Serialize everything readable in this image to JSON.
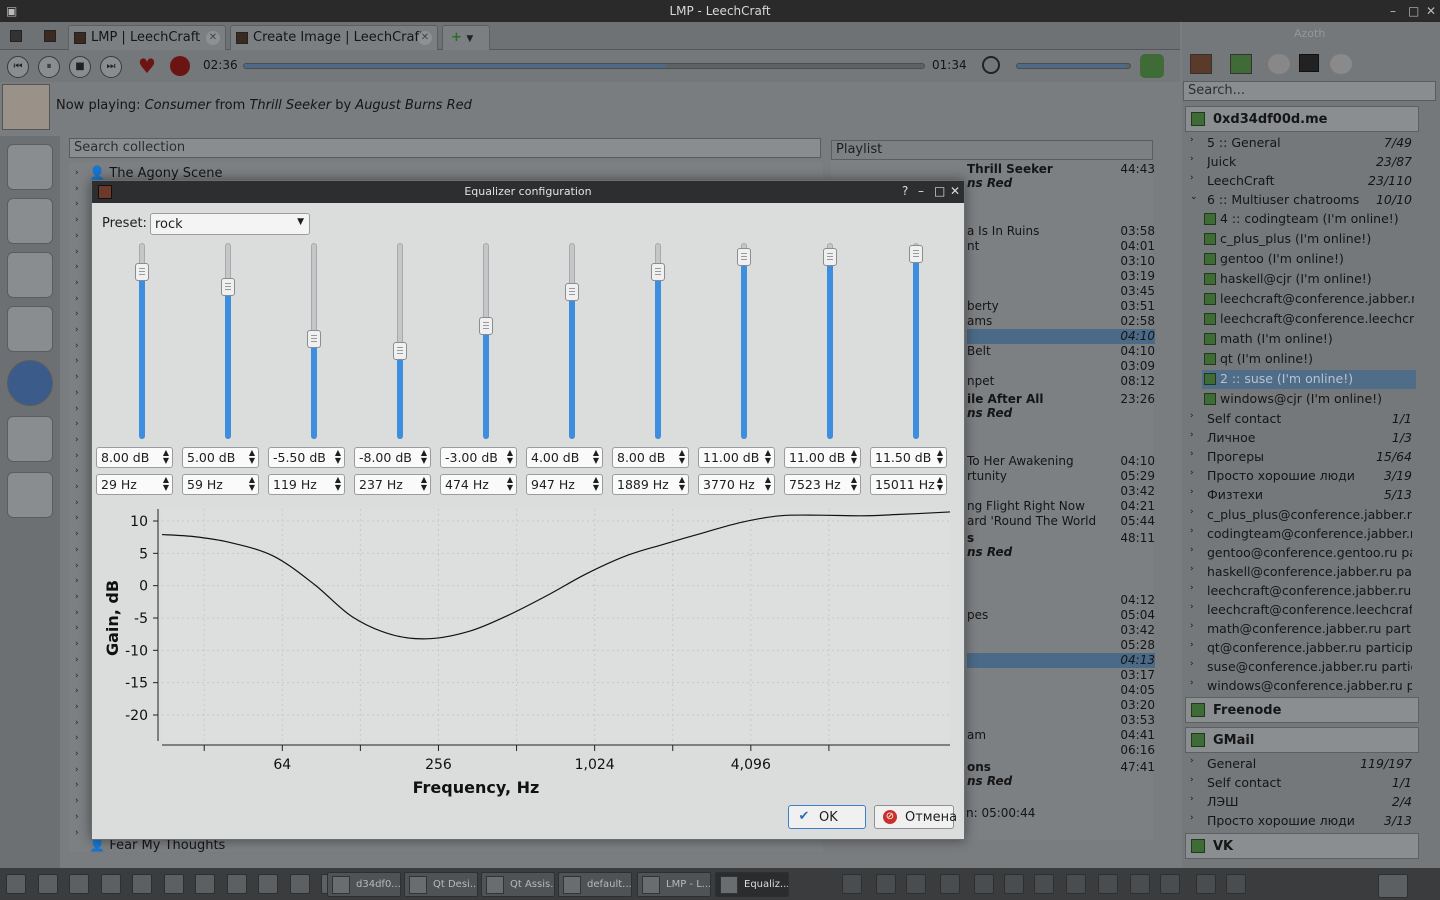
{
  "window": {
    "title": "LMP - LeechCraft"
  },
  "tabs": [
    {
      "label": "LMP | LeechCraft"
    },
    {
      "label": "Create Image | LeechCraft"
    }
  ],
  "player": {
    "elapsed": "02:36",
    "remaining": "01:34",
    "progress_fraction": 0.62,
    "volume_fraction": 0.96,
    "now_playing_prefix": "Now playing:",
    "track": "Consumer",
    "from_word": "from",
    "album": "Thrill Seeker",
    "by_word": "by",
    "artist": "August Burns Red"
  },
  "collection": {
    "search_placeholder": "Search collection",
    "first_item": "The Agony Scene",
    "last_item": "Fear My Thoughts"
  },
  "playlist": {
    "header": "Playlist",
    "album_row": {
      "title": "Thrill Seeker",
      "artist": "ns Red",
      "duration": "44:43"
    },
    "rows": [
      {
        "title": "a Is In Ruins",
        "duration": "03:58"
      },
      {
        "title": "nt",
        "duration": "04:01"
      },
      {
        "title": "",
        "duration": "03:10"
      },
      {
        "title": "",
        "duration": "03:19"
      },
      {
        "title": "",
        "duration": "03:45"
      },
      {
        "title": "berty",
        "duration": "03:51"
      },
      {
        "title": "ams",
        "duration": "02:58"
      },
      {
        "title": "",
        "duration": "04:10",
        "selected": true
      },
      {
        "title": "Belt",
        "duration": "04:10"
      },
      {
        "title": "",
        "duration": "03:09"
      },
      {
        "title": "npet",
        "duration": "08:12"
      }
    ],
    "album2": {
      "title": "ile After All",
      "artist": "ns Red",
      "duration": "23:26"
    },
    "rows2": [
      {
        "title": "To Her Awakening",
        "duration": "04:10"
      },
      {
        "title": "rtunity",
        "duration": "05:29"
      },
      {
        "title": "",
        "duration": "03:42"
      },
      {
        "title": "ng Flight Right Now",
        "duration": "04:21"
      },
      {
        "title": "ard 'Round The World",
        "duration": "05:44"
      }
    ],
    "album3": {
      "title": "s",
      "artist": "ns Red",
      "duration": "48:11"
    },
    "rows3": [
      {
        "title": "",
        "duration": "04:12"
      },
      {
        "title": "pes",
        "duration": "05:04"
      },
      {
        "title": "",
        "duration": "03:42"
      },
      {
        "title": "",
        "duration": "05:28"
      },
      {
        "title": "",
        "duration": "04:13",
        "selected": true
      },
      {
        "title": "",
        "duration": "03:17"
      },
      {
        "title": "",
        "duration": "04:05"
      },
      {
        "title": "",
        "duration": "03:20"
      },
      {
        "title": "",
        "duration": "03:53"
      },
      {
        "title": "am",
        "duration": "04:41"
      },
      {
        "title": "",
        "duration": "06:16"
      }
    ],
    "album4": {
      "title": "ons",
      "artist": "ns Red",
      "duration": "47:41"
    },
    "total": "n: 05:00:44"
  },
  "azoth": {
    "label": "Azoth",
    "search_placeholder": "Search...",
    "account1": "0xd34df00d.me",
    "groups1": [
      {
        "name": "5 :: General",
        "count": "7/49",
        "arrow": "›"
      },
      {
        "name": "Juick",
        "count": "23/87",
        "arrow": "›"
      },
      {
        "name": "LeechCraft",
        "count": "23/110",
        "arrow": "›"
      },
      {
        "name": "6 :: Multiuser chatrooms",
        "count": "10/10",
        "arrow": "⌄"
      }
    ],
    "chatrooms": [
      "4 :: codingteam (I'm online!)",
      "c_plus_plus (I'm online!)",
      "gentoo (I'm online!)",
      "haskell@cjr (I'm online!)",
      "leechcraft@conference.jabber.r...",
      "leechcraft@conference.leechcra...",
      "math (I'm online!)",
      "qt (I'm online!)",
      "2 :: suse (I'm online!)",
      "windows@cjr (I'm online!)"
    ],
    "selected_chatroom_index": 8,
    "groups2": [
      {
        "name": "Self contact",
        "count": "1/1"
      },
      {
        "name": "Личное",
        "count": "1/3"
      },
      {
        "name": "Прогеры",
        "count": "15/64"
      },
      {
        "name": "Просто хорошие люди",
        "count": "3/19"
      },
      {
        "name": "Физтехи",
        "count": "5/13"
      },
      {
        "name": "c_plus_plus@conference.jabber.r...",
        "count": ""
      },
      {
        "name": "codingteam@conference.jabber.r...",
        "count": ""
      },
      {
        "name": "gentoo@conference.gentoo.ru pa...",
        "count": ""
      },
      {
        "name": "haskell@conference.jabber.ru par...",
        "count": ""
      },
      {
        "name": "leechcraft@conference.jabber.ru ...",
        "count": ""
      },
      {
        "name": "leechcraft@conference.leechcraft...",
        "count": ""
      },
      {
        "name": "math@conference.jabber.ru parti...",
        "count": ""
      },
      {
        "name": "qt@conference.jabber.ru particip...",
        "count": ""
      },
      {
        "name": "suse@conference.jabber.ru partic...",
        "count": ""
      },
      {
        "name": "windows@conference.jabber.ru p...",
        "count": ""
      }
    ],
    "account2": "Freenode",
    "account3": "GMail",
    "groups3": [
      {
        "name": "General",
        "count": "119/197"
      },
      {
        "name": "Self contact",
        "count": "1/1"
      },
      {
        "name": "ЛЭШ",
        "count": "2/4"
      },
      {
        "name": "Просто хорошие люди",
        "count": "3/13"
      }
    ],
    "account4": "VK"
  },
  "taskbar": {
    "items": [
      "d34df0...",
      "Qt Desi...",
      "Qt Assis...",
      "default...",
      "LMP - L...",
      "Equaliz..."
    ]
  },
  "equalizer": {
    "title": "Equalizer configuration",
    "preset_label": "Preset:",
    "preset_value": "rock",
    "gain_min": -24,
    "gain_max": 12,
    "bands": [
      {
        "gain": 8.0,
        "gain_text": "8.00 dB",
        "freq": 29,
        "freq_text": "29 Hz"
      },
      {
        "gain": 5.0,
        "gain_text": "5.00 dB",
        "freq": 59,
        "freq_text": "59 Hz"
      },
      {
        "gain": -5.5,
        "gain_text": "-5.50 dB",
        "freq": 119,
        "freq_text": "119 Hz"
      },
      {
        "gain": -8.0,
        "gain_text": "-8.00 dB",
        "freq": 237,
        "freq_text": "237 Hz"
      },
      {
        "gain": -3.0,
        "gain_text": "-3.00 dB",
        "freq": 474,
        "freq_text": "474 Hz"
      },
      {
        "gain": 4.0,
        "gain_text": "4.00 dB",
        "freq": 947,
        "freq_text": "947 Hz"
      },
      {
        "gain": 8.0,
        "gain_text": "8.00 dB",
        "freq": 1889,
        "freq_text": "1889 Hz"
      },
      {
        "gain": 11.0,
        "gain_text": "11.00 dB",
        "freq": 3770,
        "freq_text": "3770 Hz"
      },
      {
        "gain": 11.0,
        "gain_text": "11.00 dB",
        "freq": 7523,
        "freq_text": "7523 Hz"
      },
      {
        "gain": 11.5,
        "gain_text": "11.50 dB",
        "freq": 15011,
        "freq_text": "15011 Hz"
      }
    ],
    "ok_label": "OK",
    "cancel_label": "Отмена"
  },
  "chart_data": {
    "type": "line",
    "xlabel": "Frequency, Hz",
    "ylabel": "Gain, dB",
    "x_scale": "log2",
    "xlim": [
      22,
      24000
    ],
    "ylim": [
      -24,
      12
    ],
    "xticks": [
      64,
      256,
      1024,
      4096
    ],
    "xtick_labels": [
      "64",
      "256",
      "1,024",
      "4,096"
    ],
    "yticks": [
      10,
      5,
      0,
      -5,
      -10,
      -15,
      -20
    ],
    "grid": true,
    "x": [
      22,
      29,
      40,
      59,
      85,
      119,
      170,
      237,
      340,
      474,
      680,
      947,
      1350,
      1889,
      2700,
      3770,
      5300,
      7523,
      11000,
      15011,
      24000
    ],
    "y": [
      7.9,
      7.6,
      6.7,
      4.6,
      0.2,
      -4.8,
      -7.6,
      -8.2,
      -7.0,
      -4.6,
      -1.4,
      1.8,
      4.6,
      6.4,
      8.2,
      9.8,
      10.8,
      10.9,
      10.8,
      11.0,
      11.4
    ]
  }
}
